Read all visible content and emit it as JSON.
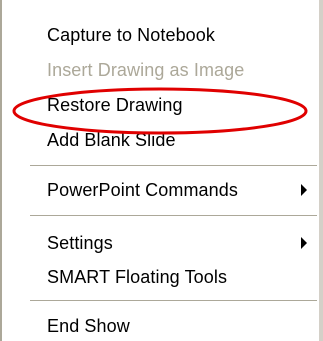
{
  "menu": {
    "items": [
      {
        "label": "Capture to Notebook",
        "disabled": false
      },
      {
        "label": "Insert Drawing as Image",
        "disabled": true
      },
      {
        "label": "Restore Drawing",
        "disabled": false
      },
      {
        "label": "Add Blank Slide",
        "disabled": false
      },
      {
        "label": "PowerPoint Commands",
        "disabled": false,
        "submenu": true
      },
      {
        "label": "Settings",
        "disabled": false,
        "submenu": true
      },
      {
        "label": "SMART Floating Tools",
        "disabled": false
      },
      {
        "label": "End Show",
        "disabled": false
      }
    ]
  },
  "colors": {
    "text": "#000000",
    "disabled_text": "#aca899",
    "separator": "#aca899",
    "highlight_ellipse": "#e00000"
  },
  "icons": {
    "submenu_arrow": "triangle-right"
  }
}
